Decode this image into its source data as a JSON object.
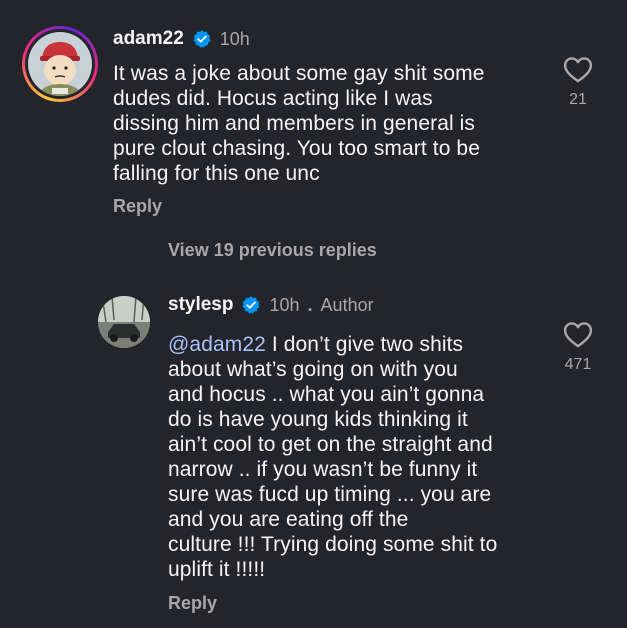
{
  "comments": [
    {
      "username": "adam22",
      "time": "10h",
      "lines": [
        "It was a joke about some gay shit some",
        "dudes did. Hocus acting like I was",
        "dissing him and members in general is",
        "pure clout chasing. You too smart to be",
        "falling for this one unc"
      ],
      "reply_label": "Reply",
      "like_count": "21"
    },
    {
      "username": "stylesp",
      "time": "10h",
      "separator": ".",
      "author_badge": "Author",
      "mention": "@adam22",
      "first_line_rest": " I don’t give two shits",
      "lines": [
        "about what’s going on with you",
        "and hocus .. what you ain’t gonna",
        "do is have young kids thinking it",
        "ain’t cool to get on the straight and",
        "narrow .. if you wasn’t be funny it",
        "sure was fucd up timing ... you are",
        "and you are eating off the",
        "culture !!! Trying doing some shit to",
        "uplift it !!!!!"
      ],
      "reply_label": "Reply",
      "like_count": "471"
    }
  ],
  "view_replies": "View 19 previous replies",
  "colors": {
    "background": "#24252a",
    "primary_text": "#f5f5f5",
    "secondary_text": "#a8a8a8",
    "mention": "#a9c1ff",
    "verified": "#0095f6"
  },
  "icons": [
    "verified-badge-icon",
    "heart-icon"
  ]
}
